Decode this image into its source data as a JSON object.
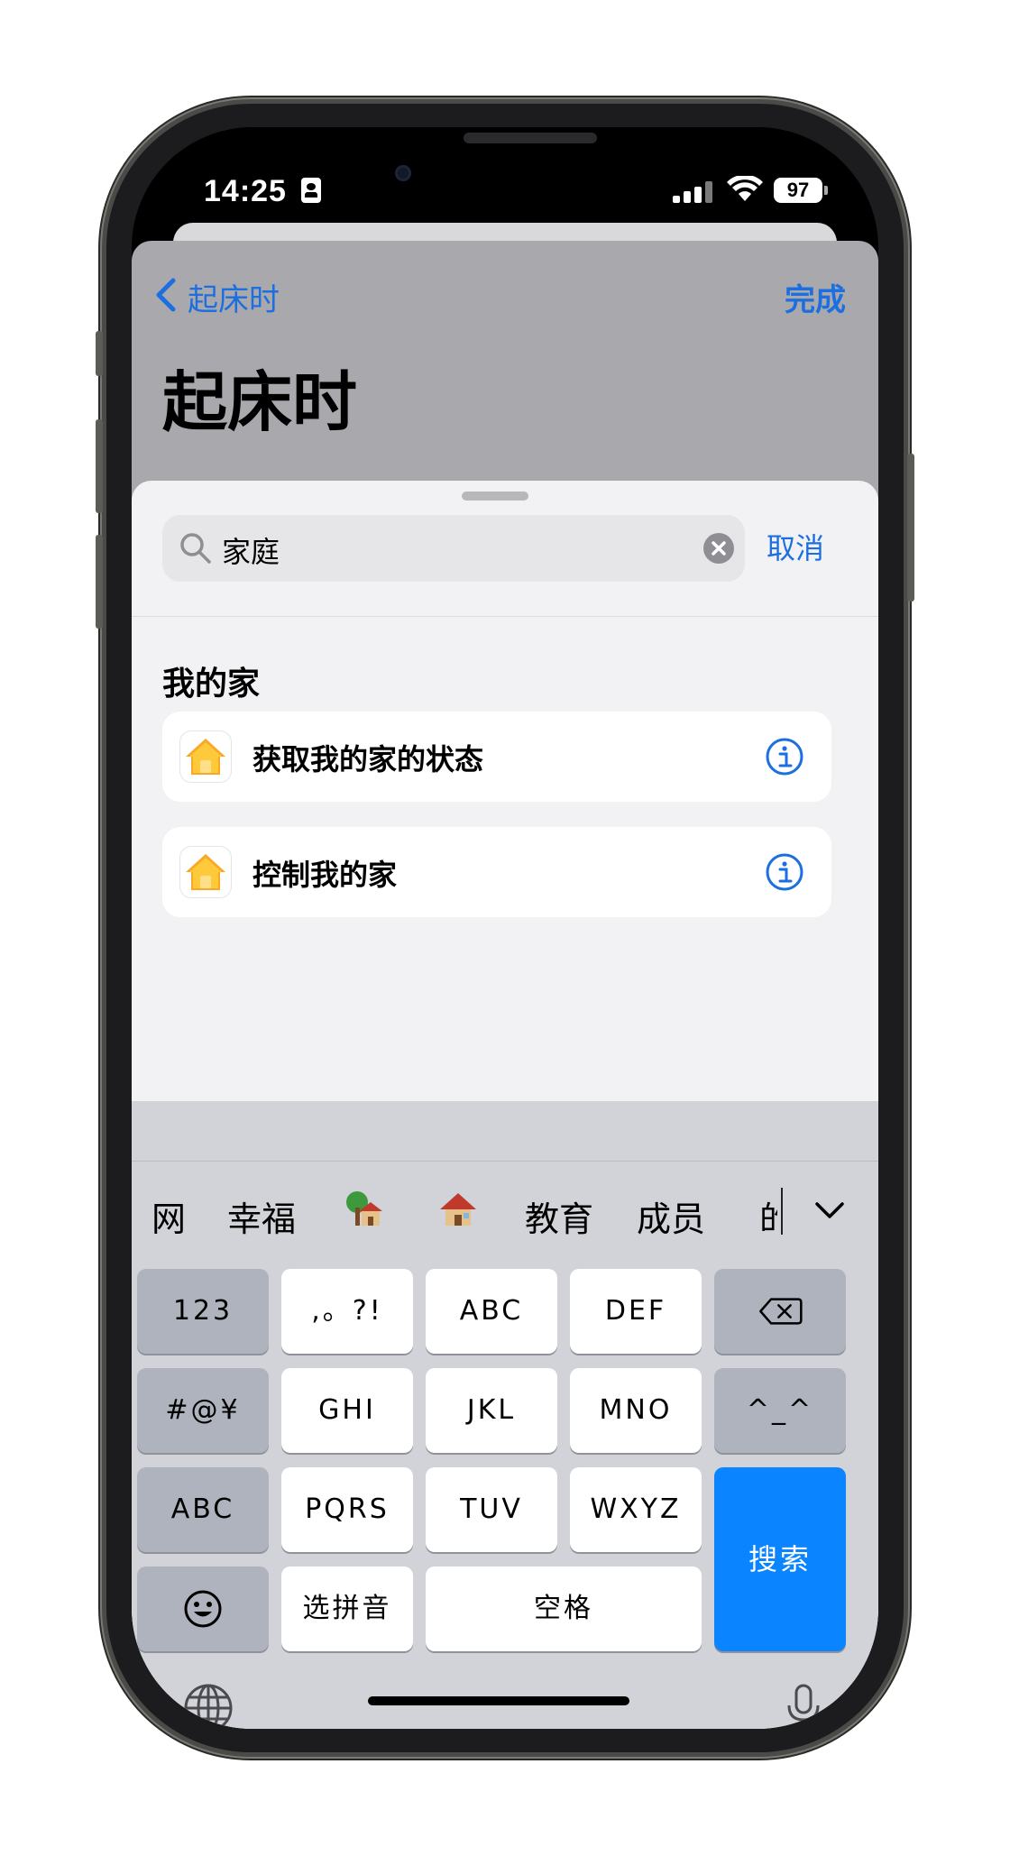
{
  "status_bar": {
    "time": "14:25",
    "battery": "97"
  },
  "nav": {
    "back_label": "起床时",
    "done_label": "完成",
    "title": "起床时"
  },
  "search": {
    "query": "家庭",
    "cancel_label": "取消"
  },
  "section_title": "我的家",
  "actions": [
    {
      "label": "获取我的家的状态",
      "icon": "home-app-icon"
    },
    {
      "label": "控制我的家",
      "icon": "home-app-icon"
    }
  ],
  "candidates": [
    "网",
    "幸福",
    "tree-house-emoji",
    "house-emoji",
    "教育",
    "成员",
    "的"
  ],
  "keys": {
    "row1": [
      "123",
      ",。?!",
      "ABC",
      "DEF"
    ],
    "row2": [
      "#@¥",
      "GHI",
      "JKL",
      "MNO",
      "^_^"
    ],
    "row3": [
      "ABC",
      "PQRS",
      "TUV",
      "WXYZ"
    ],
    "row4": [
      "选拼音",
      "空格"
    ],
    "search": "搜索"
  },
  "colors": {
    "accent": "#1d6fe0",
    "search_key": "#0b84ff",
    "keyboard_bg": "#d1d3d9"
  }
}
